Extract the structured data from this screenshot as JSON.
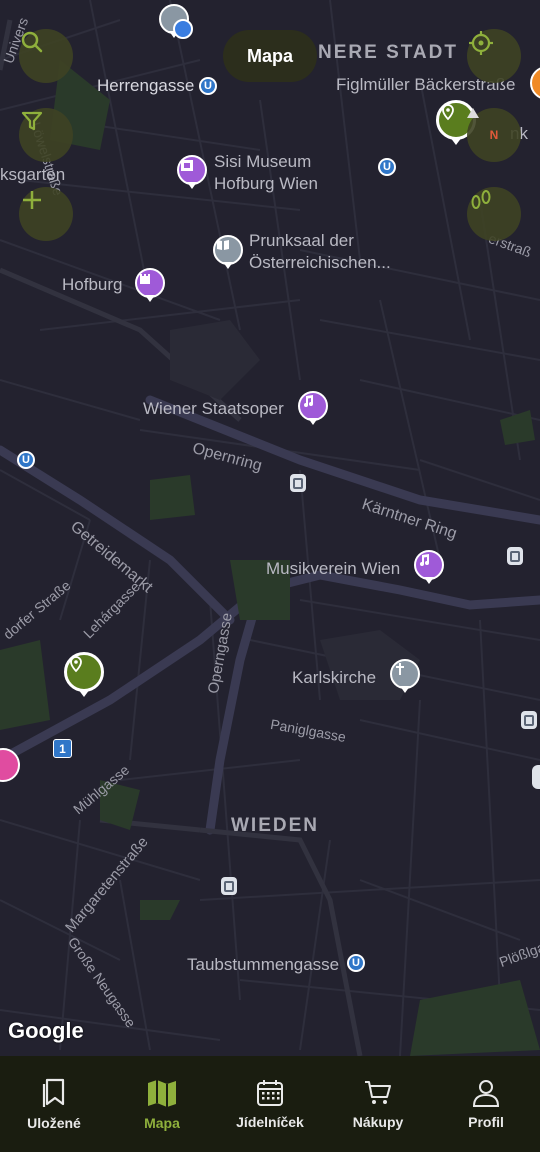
{
  "map": {
    "labels": {
      "innere_stadt": "NERE STADT",
      "herrengasse": "Herrengasse",
      "figlmueller": "Figlmüller Bäckerstraße",
      "loewelstrasse": "Löwelstraße",
      "volksgarten": "ksgarten",
      "sisi_line1": "Sisi Museum",
      "sisi_line2": "Hofburg Wien",
      "prunksaal_line1": "Prunksaal der",
      "prunksaal_line2": "Österreichischen...",
      "hofburg": "Hofburg",
      "staatsoper": "Wiener Staatsoper",
      "opernring": "Opernring",
      "kaerntner_ring": "Kärntner Ring",
      "getreidemarkt": "Getreidemarkt",
      "musikverein": "Musikverein Wien",
      "dorfer_strasse": "dorfer Straße",
      "lehargasse": "Lehárgasse",
      "operngasse": "Operngasse",
      "karlskirche": "Karlskirche",
      "paniglgasse": "Paniglgasse",
      "muehlgasse": "Mühlgasse",
      "wieden": "WIEDEN",
      "margaretenstrasse": "Margaretenstraße",
      "grosse_neugasse": "Große Neugasse",
      "taubstummengasse": "Taubstummengasse",
      "ploesslgasse": "Plößlga",
      "rstrasse": "erstraß",
      "univers": "Univers",
      "nk": "nk",
      "ubahn_symbol": "U",
      "route_number": "1",
      "compass_letter": "N"
    },
    "attribution": "Google",
    "controls": {
      "mapa_label": "Mapa"
    }
  },
  "nav": {
    "items": [
      {
        "label": "Uložené",
        "icon": "bookmark-icon"
      },
      {
        "label": "Mapa",
        "icon": "map-icon",
        "active": true
      },
      {
        "label": "Jídelníček",
        "icon": "calendar-icon"
      },
      {
        "label": "Nákupy",
        "icon": "cart-icon"
      },
      {
        "label": "Profil",
        "icon": "person-icon"
      }
    ]
  },
  "colors": {
    "map_background": "#23222f",
    "accent_green": "#8fb03c",
    "nav_background": "#1a1d10",
    "poi_purple": "#9f5ad8"
  }
}
